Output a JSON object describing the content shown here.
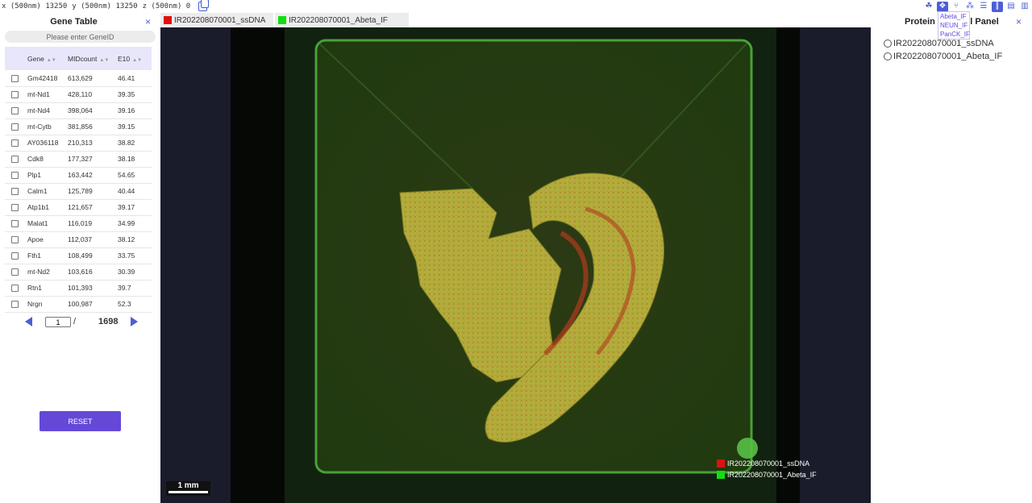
{
  "coords": {
    "x_label": "x (500nm)",
    "x_value": "13250",
    "y_label": "y (500nm)",
    "y_value": "13250",
    "z_label": "z (500nm)",
    "z_value": "0"
  },
  "toolbar": {
    "icons": [
      "lasso-icon",
      "nodes-icon",
      "tree-icon",
      "network-icon",
      "sliders-icon",
      "bars-icon",
      "notes-icon",
      "document-icon"
    ],
    "active_index": 1
  },
  "layer_dropdown": [
    "Abeta_IF",
    "NEUN_IF",
    "PanCK_IF"
  ],
  "gene_panel": {
    "title": "Gene Table",
    "close": "×",
    "search_placeholder": "Please enter GeneID",
    "columns": [
      "Gene",
      "MIDcount",
      "E10"
    ],
    "rows": [
      [
        "Gm42418",
        "613,629",
        "46.41"
      ],
      [
        "mt-Nd1",
        "428,110",
        "39.35"
      ],
      [
        "mt-Nd4",
        "398,064",
        "39.16"
      ],
      [
        "mt-Cytb",
        "381,856",
        "39.15"
      ],
      [
        "AY036118",
        "210,313",
        "38.82"
      ],
      [
        "Cdk8",
        "177,327",
        "38.18"
      ],
      [
        "Plp1",
        "163,442",
        "54.65"
      ],
      [
        "Calm1",
        "125,789",
        "40.44"
      ],
      [
        "Atp1b1",
        "121,657",
        "39.17"
      ],
      [
        "Malat1",
        "116,019",
        "34.99"
      ],
      [
        "Apoe",
        "112,037",
        "38.12"
      ],
      [
        "Fth1",
        "108,499",
        "33.75"
      ],
      [
        "mt-Nd2",
        "103,616",
        "30.39"
      ],
      [
        "Rtn1",
        "101,393",
        "39.7"
      ],
      [
        "Nrgn",
        "100,987",
        "52.3"
      ]
    ],
    "pager": {
      "current": "1",
      "separator": "/",
      "total": "1698"
    },
    "reset_label": "RESET"
  },
  "tabs": [
    {
      "label": "IR202208070001_ssDNA",
      "color": "#e01010"
    },
    {
      "label": "IR202208070001_Abeta_IF",
      "color": "#10e010"
    }
  ],
  "legend": [
    {
      "label": "IR202208070001_ssDNA",
      "color": "#e01010"
    },
    {
      "label": "IR202208070001_Abeta_IF",
      "color": "#10e010"
    }
  ],
  "scale_bar": "1 mm",
  "protein_panel": {
    "title": "Protein Channel Panel",
    "close": "×",
    "options": [
      "IR202208070001_ssDNA",
      "IR202208070001_Abeta_IF"
    ]
  }
}
